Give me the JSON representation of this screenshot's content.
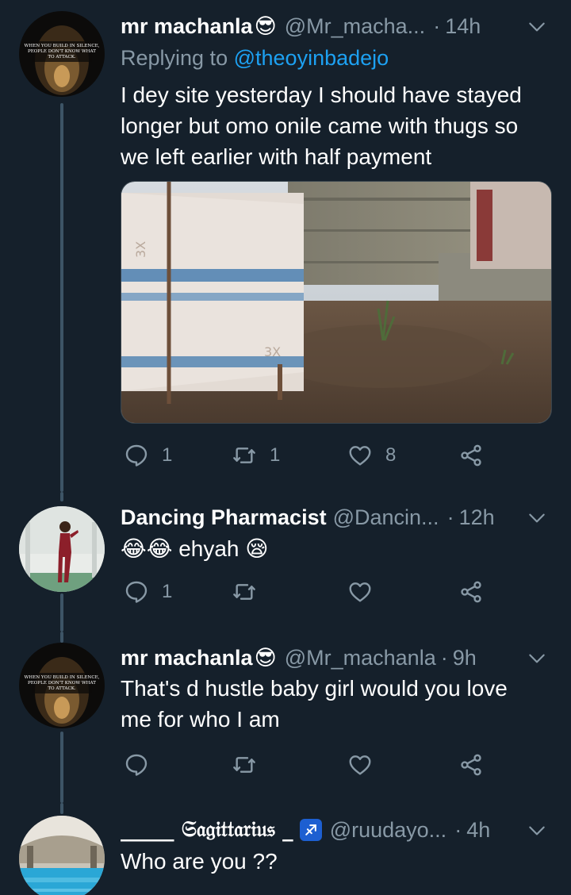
{
  "tweets": [
    {
      "display_name": "mr machanla",
      "name_emoji": "😎",
      "handle": "@Mr_macha...",
      "time": "14h",
      "reply_prefix": "Replying to",
      "reply_to": "@theoyinbadejo",
      "text_lines": [
        "I dey site yesterday I should have stayed",
        "longer but omo onile came with thugs so",
        "we left earlier with half payment"
      ],
      "avatar_caption": [
        "WHEN YOU BUILD IN SILENCE,",
        "PEOPLE DON'T KNOW WHAT",
        "TO ATTACK."
      ],
      "reply_count": "1",
      "retweet_count": "1",
      "like_count": "8"
    },
    {
      "display_name": "Dancing Pharmacist",
      "handle": "@Dancin...",
      "time": "12h",
      "text": "😂😂 ehyah 😪",
      "reply_count": "1",
      "retweet_count": "",
      "like_count": ""
    },
    {
      "display_name": "mr machanla",
      "name_emoji": "😎",
      "handle": "@Mr_machanla",
      "time": "9h",
      "text_lines": [
        "That's d hustle baby girl would you love",
        "me for who I am"
      ],
      "avatar_caption": [
        "WHEN YOU BUILD IN SILENCE,",
        "PEOPLE DON'T KNOW WHAT",
        "TO ATTACK."
      ],
      "reply_count": "",
      "retweet_count": "",
      "like_count": ""
    },
    {
      "display_name": "_____ 𝔖𝔞𝔤𝔦𝔱𝔱𝔞𝔯𝔦𝔲𝔰 _",
      "name_emoji": "♐",
      "handle": "@ruudayo...",
      "time": "4h",
      "text": "Who are you ??"
    }
  ],
  "dot": "·",
  "colors": {
    "background": "#15202b",
    "secondary_text": "#8899a6",
    "link": "#1da1f2",
    "divider": "#38444d",
    "thread_line": "#3d5466"
  },
  "icons": {
    "reply": "speech-bubble-icon",
    "retweet": "retweet-arrows-icon",
    "like": "heart-icon",
    "share": "share-nodes-icon",
    "menu": "chevron-down-icon",
    "badge": "sagittarius-icon"
  }
}
